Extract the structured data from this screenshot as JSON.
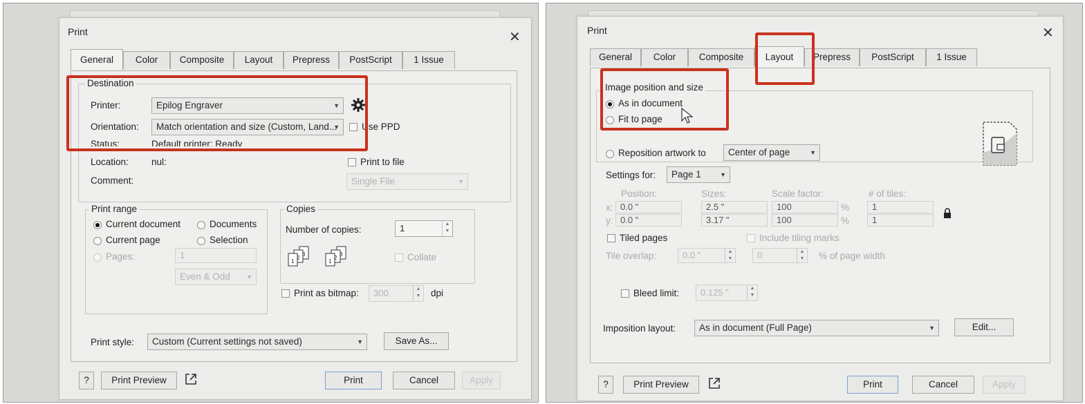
{
  "left": {
    "title": "Print",
    "tabs": [
      "General",
      "Color",
      "Composite",
      "Layout",
      "Prepress",
      "PostScript",
      "1 Issue"
    ],
    "destination": {
      "legend": "Destination",
      "printer_label": "Printer:",
      "printer_value": "Epilog Engraver",
      "orientation_label": "Orientation:",
      "orientation_value": "Match orientation and size (Custom, Land...",
      "use_ppd_label": "Use PPD",
      "status_label": "Status:",
      "status_value": "Default printer; Ready",
      "location_label": "Location:",
      "location_value": "nul:",
      "comment_label": "Comment:",
      "print_to_file_label": "Print to file",
      "file_mode_value": "Single File"
    },
    "print_range": {
      "legend": "Print range",
      "current_document": "Current document",
      "documents": "Documents",
      "current_page": "Current page",
      "selection": "Selection",
      "pages_label": "Pages:",
      "pages_value": "1",
      "parity_value": "Even & Odd"
    },
    "copies": {
      "legend": "Copies",
      "number_label": "Number of copies:",
      "number_value": "1",
      "collate_label": "Collate"
    },
    "bitmap": {
      "label": "Print as bitmap:",
      "dpi_value": "300",
      "dpi_unit": "dpi"
    },
    "print_style": {
      "label": "Print style:",
      "value": "Custom (Current settings not saved)",
      "save_as": "Save As..."
    },
    "footer": {
      "help": "?",
      "preview": "Print Preview",
      "print": "Print",
      "cancel": "Cancel",
      "apply": "Apply"
    }
  },
  "right": {
    "title": "Print",
    "tabs": [
      "General",
      "Color",
      "Composite",
      "Layout",
      "Prepress",
      "PostScript",
      "1 Issue"
    ],
    "image_position": {
      "legend": "Image position and size",
      "as_in_document": "As in document",
      "fit_to_page": "Fit to page",
      "reposition_label": "Reposition artwork to",
      "reposition_value": "Center of page"
    },
    "settings_for": {
      "label": "Settings for:",
      "value": "Page 1"
    },
    "grid": {
      "col_position": "Position:",
      "col_sizes": "Sizes:",
      "col_scale": "Scale factor:",
      "col_tiles": "# of tiles:",
      "x_label": "x:",
      "y_label": "y:",
      "x_value": "0.0 \"",
      "y_value": "0.0 \"",
      "width_value": "2.5 \"",
      "height_value": "3.17 \"",
      "scale_x": "100",
      "scale_y": "100",
      "percent": "%",
      "tiles_x": "1",
      "tiles_y": "1"
    },
    "tiled": {
      "tiled_pages": "Tiled pages",
      "include_marks": "Include tiling marks",
      "overlap_label": "Tile overlap:",
      "overlap_value": "0.0 \"",
      "overlap_pct_value": "0",
      "pct_width_label": "% of page width"
    },
    "bleed": {
      "label": "Bleed limit:",
      "value": "0.125 \""
    },
    "imposition": {
      "label": "Imposition layout:",
      "value": "As in document (Full Page)",
      "edit": "Edit..."
    },
    "footer": {
      "help": "?",
      "preview": "Print Preview",
      "print": "Print",
      "cancel": "Cancel",
      "apply": "Apply"
    }
  },
  "colors": {
    "highlight": "#c8321e",
    "panel_bg": "#d9dad6",
    "dialog_bg": "#ececea",
    "default_button_border": "#7aa0cf"
  }
}
